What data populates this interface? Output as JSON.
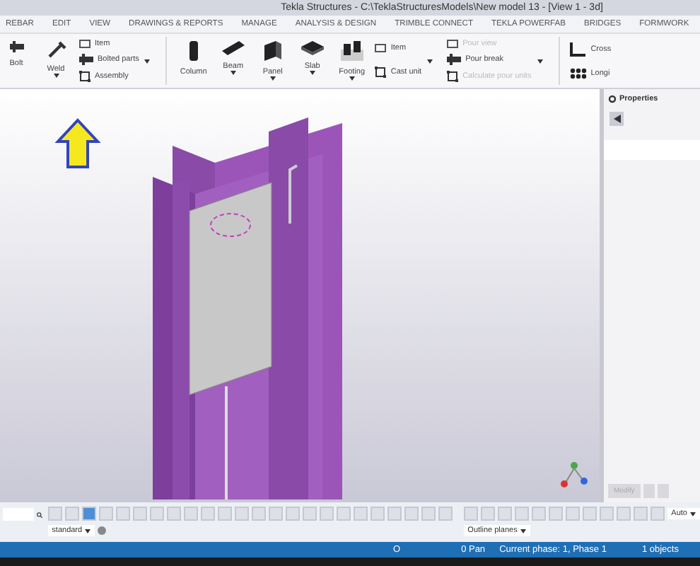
{
  "window": {
    "title": "Tekla Structures - C:\\TeklaStructuresModels\\New model 13  - [View 1 - 3d]"
  },
  "tabs": [
    "REBAR",
    "EDIT",
    "VIEW",
    "DRAWINGS & REPORTS",
    "MANAGE",
    "ANALYSIS & DESIGN",
    "TRIMBLE CONNECT",
    "TEKLA POWERFAB",
    "BRIDGES",
    "FORMWORK"
  ],
  "ribbon": [
    {
      "kind": "big",
      "label": "Bolt",
      "dropdown": false
    },
    {
      "kind": "big",
      "label": "Weld",
      "dropdown": true
    },
    {
      "kind": "stack",
      "more": true,
      "items": [
        {
          "label": "Item",
          "disabled": false
        },
        {
          "label": "Bolted parts",
          "disabled": false
        },
        {
          "label": "Assembly",
          "disabled": false
        }
      ]
    },
    {
      "kind": "separator"
    },
    {
      "kind": "big",
      "label": "Column",
      "dropdown": false
    },
    {
      "kind": "big",
      "label": "Beam",
      "dropdown": true
    },
    {
      "kind": "big",
      "label": "Panel",
      "dropdown": true
    },
    {
      "kind": "big",
      "label": "Slab",
      "dropdown": true
    },
    {
      "kind": "big",
      "label": "Footing",
      "dropdown": true
    },
    {
      "kind": "stack",
      "more": true,
      "items": [
        {
          "label": "Item",
          "disabled": false
        },
        {
          "label": "Cast unit",
          "disabled": false
        }
      ]
    },
    {
      "kind": "stack",
      "more": true,
      "items": [
        {
          "label": "Pour view",
          "disabled": true
        },
        {
          "label": "Pour break",
          "disabled": false
        },
        {
          "label": "Calculate pour units",
          "disabled": true
        }
      ]
    },
    {
      "kind": "separator"
    },
    {
      "kind": "stack",
      "more": false,
      "items": [
        {
          "label": "Cross",
          "disabled": false
        },
        {
          "label": "Longi",
          "disabled": false
        }
      ]
    }
  ],
  "properties": {
    "title": "Properties",
    "button": "Modify"
  },
  "toolbar": {
    "display": "standard",
    "planes": "Outline planes",
    "snap": "Auto"
  },
  "status_bar": [
    "O",
    "0 Pan",
    "Current phase: 1, Phase 1",
    "1 objects"
  ]
}
